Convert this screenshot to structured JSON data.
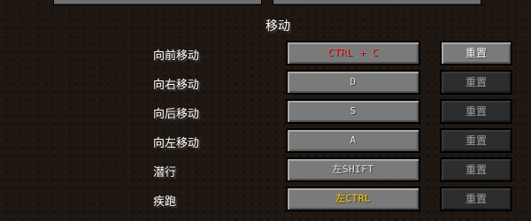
{
  "category": {
    "title": "移动"
  },
  "bindings": [
    {
      "action": "向前移动",
      "key": "CTRL + C",
      "key_prefix": "",
      "key_main": "CTRL + C",
      "reset_label": "重置",
      "state": "conflict",
      "reset_enabled": true
    },
    {
      "action": "向右移动",
      "key": "D",
      "key_prefix": "",
      "key_main": "D",
      "reset_label": "重置",
      "state": "default",
      "reset_enabled": false
    },
    {
      "action": "向后移动",
      "key": "S",
      "key_prefix": "",
      "key_main": "S",
      "reset_label": "重置",
      "state": "default",
      "reset_enabled": false
    },
    {
      "action": "向左移动",
      "key": "A",
      "key_prefix": "",
      "key_main": "A",
      "reset_label": "重置",
      "state": "default",
      "reset_enabled": false
    },
    {
      "action": "潜行",
      "key": "左SHIFT",
      "key_prefix": "左",
      "key_main": "SHIFT",
      "reset_label": "重置",
      "state": "default",
      "reset_enabled": false
    },
    {
      "action": "疾跑",
      "key": "左CTRL",
      "key_prefix": "左",
      "key_main": "CTRL",
      "reset_label": "重置",
      "state": "default",
      "reset_enabled": false
    }
  ],
  "colors": {
    "conflict_text": "#ff5555",
    "key_text": "#e0e0e0",
    "highlight_key_text": "#ffcc00",
    "button_bg": "#7a7a7a",
    "disabled_button_bg": "#2d2d2d",
    "background": "#2a2018"
  }
}
